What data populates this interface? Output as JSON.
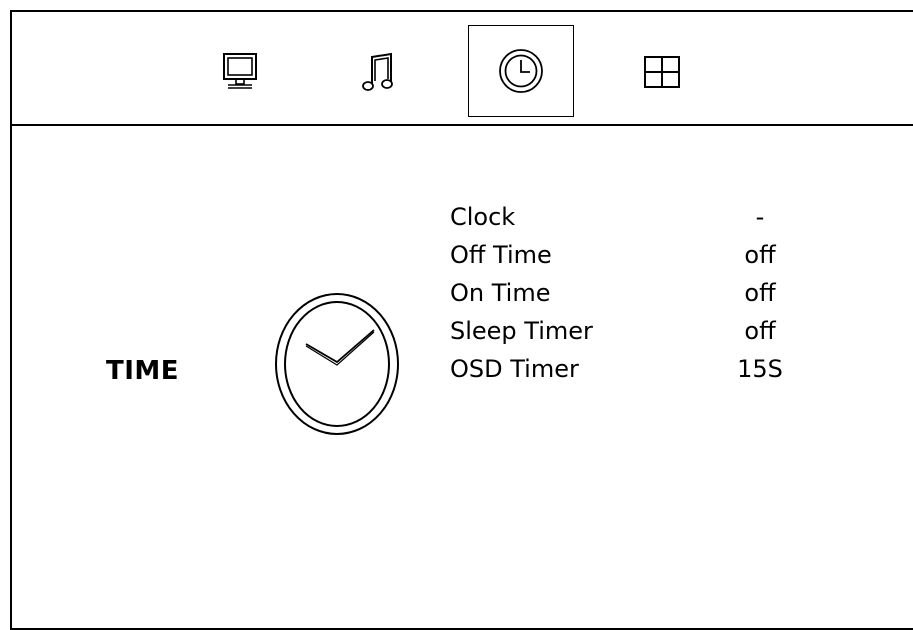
{
  "tabs": [
    {
      "name": "picture",
      "icon": "monitor-icon",
      "selected": false
    },
    {
      "name": "sound",
      "icon": "music-note-icon",
      "selected": false
    },
    {
      "name": "time",
      "icon": "clock-icon",
      "selected": true
    },
    {
      "name": "option",
      "icon": "grid-icon",
      "selected": false
    }
  ],
  "section": {
    "title": "TIME",
    "icon": "clock-icon"
  },
  "menu": {
    "items": [
      {
        "label": "Clock",
        "value": "-"
      },
      {
        "label": "Off Time",
        "value": "off"
      },
      {
        "label": "On Time",
        "value": "off"
      },
      {
        "label": "Sleep Timer",
        "value": "off"
      },
      {
        "label": "OSD Timer",
        "value": "15S"
      }
    ]
  },
  "colors": {
    "foreground": "#000000",
    "background": "#ffffff"
  }
}
